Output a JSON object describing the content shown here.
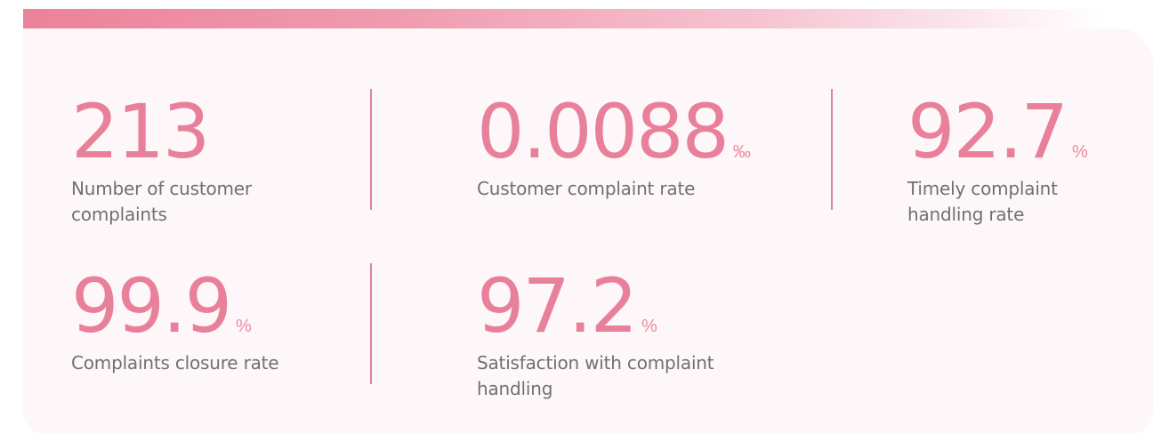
{
  "metrics": [
    {
      "value": "213",
      "unit": "",
      "label": "Number of customer complaints"
    },
    {
      "value": "0.0088",
      "unit": "‰",
      "label": "Customer complaint rate"
    },
    {
      "value": "92.7",
      "unit": "%",
      "label": "Timely complaint handling rate"
    },
    {
      "value": "99.9",
      "unit": "%",
      "label": "Complaints closure rate"
    },
    {
      "value": "97.2",
      "unit": "%",
      "label": "Satisfaction with complaint handling"
    }
  ],
  "colors": {
    "accent": "#e9809a",
    "label": "#707070",
    "panel": "#fdf7f9",
    "divider": "#d88799"
  }
}
